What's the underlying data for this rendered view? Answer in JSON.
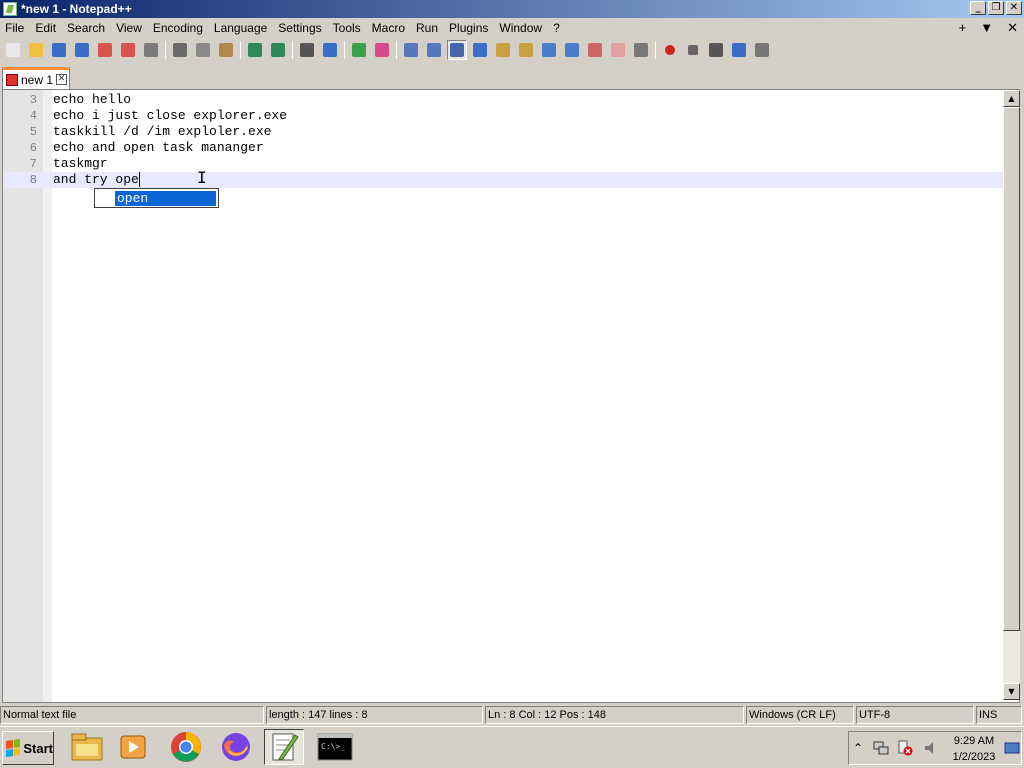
{
  "window": {
    "title": "*new 1 - Notepad++"
  },
  "menu": [
    "File",
    "Edit",
    "Search",
    "View",
    "Encoding",
    "Language",
    "Settings",
    "Tools",
    "Macro",
    "Run",
    "Plugins",
    "Window",
    "?"
  ],
  "menu_right": {
    "plus": "+",
    "dropdown": "▼",
    "close": "✕"
  },
  "tab": {
    "label": "new 1"
  },
  "editor": {
    "lines": [
      {
        "number": "3",
        "text": "echo hello"
      },
      {
        "number": "4",
        "text": "echo i just close explorer.exe"
      },
      {
        "number": "5",
        "text": "taskkill /d /im exploler.exe"
      },
      {
        "number": "6",
        "text": "echo and open task mananger"
      },
      {
        "number": "7",
        "text": "taskmgr"
      },
      {
        "number": "8",
        "text": "and try ope"
      }
    ],
    "autocomplete": {
      "item": "open"
    }
  },
  "status": {
    "file_type": "Normal text file",
    "length_lines": "length : 147    lines : 8",
    "position": "Ln : 8    Col : 12    Pos : 148",
    "eol": "Windows (CR LF)",
    "encoding": "UTF-8",
    "mode": "INS"
  },
  "taskbar": {
    "start_label": "Start",
    "clock_time": "9:29 AM",
    "clock_date": "1/2/2023",
    "cmd_label": "C:\\>_"
  },
  "toolbar_icons": [
    "new-file-icon",
    "open-file-icon",
    "save-icon",
    "save-all-icon",
    "close-icon",
    "close-all-icon",
    "print-icon",
    "cut-icon",
    "copy-icon",
    "paste-icon",
    "undo-icon",
    "redo-icon",
    "find-icon",
    "replace-icon",
    "zoom-in-icon",
    "zoom-out-icon",
    "sync-vertical-icon",
    "sync-horizontal-icon",
    "word-wrap-icon",
    "show-all-chars-icon",
    "indent-guide-icon",
    "user-language-icon",
    "doc-map-icon",
    "function-list-icon",
    "folder-workspace-icon",
    "document-list-icon",
    "monitoring-icon",
    "record-macro-icon",
    "stop-record-icon",
    "play-macro-icon",
    "run-macro-multiple-icon",
    "save-macro-icon"
  ]
}
